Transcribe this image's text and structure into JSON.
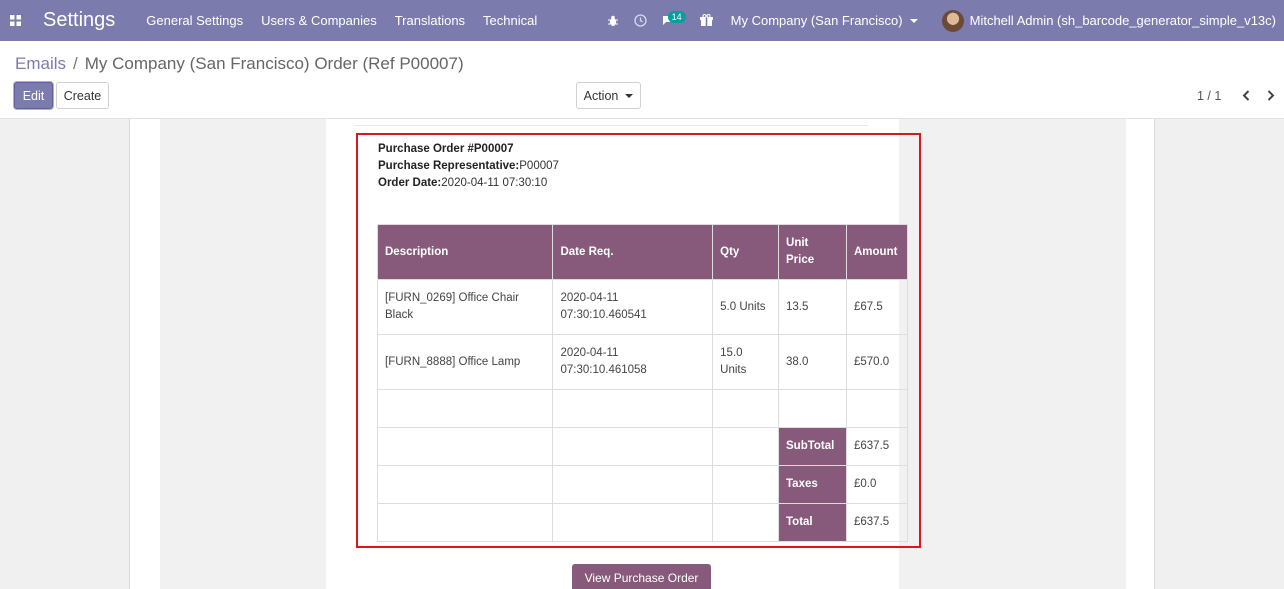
{
  "navbar": {
    "app_title": "Settings",
    "menu": [
      "General Settings",
      "Users & Companies",
      "Translations",
      "Technical"
    ],
    "messages_badge": "14",
    "company": "My Company (San Francisco)",
    "user": "Mitchell Admin (sh_barcode_generator_simple_v13c)",
    "bg_color": "#7c7bad"
  },
  "breadcrumb": {
    "parent": "Emails",
    "separator": "/",
    "current": "My Company (San Francisco) Order (Ref P00007)"
  },
  "buttons": {
    "edit": "Edit",
    "create": "Create",
    "action": "Action"
  },
  "pager": {
    "value": "1 / 1"
  },
  "email": {
    "order_label": "Purchase Order #P00007",
    "rep_label": "Purchase Representative:",
    "rep_value": "P00007",
    "date_label": "Order Date:",
    "date_value": "2020-04-11 07:30:10",
    "columns": [
      "Description",
      "Date Req.",
      "Qty",
      "Unit Price",
      "Amount"
    ],
    "rows": [
      {
        "desc": "[FURN_0269] Office Chair Black",
        "date": "2020-04-11 07:30:10.460541",
        "qty": "5.0 Units",
        "price": "13.5",
        "amount": "£67.5"
      },
      {
        "desc": "[FURN_8888] Office Lamp",
        "date": "2020-04-11 07:30:10.461058",
        "qty": "15.0 Units",
        "price": "38.0",
        "amount": "£570.0"
      }
    ],
    "totals": [
      {
        "label": "SubTotal",
        "value": "£637.5"
      },
      {
        "label": "Taxes",
        "value": "£0.0"
      },
      {
        "label": "Total",
        "value": "£637.5"
      }
    ],
    "view_button": "View Purchase Order",
    "header_color": "#875a7b",
    "highlight_color": "#d6181f"
  }
}
